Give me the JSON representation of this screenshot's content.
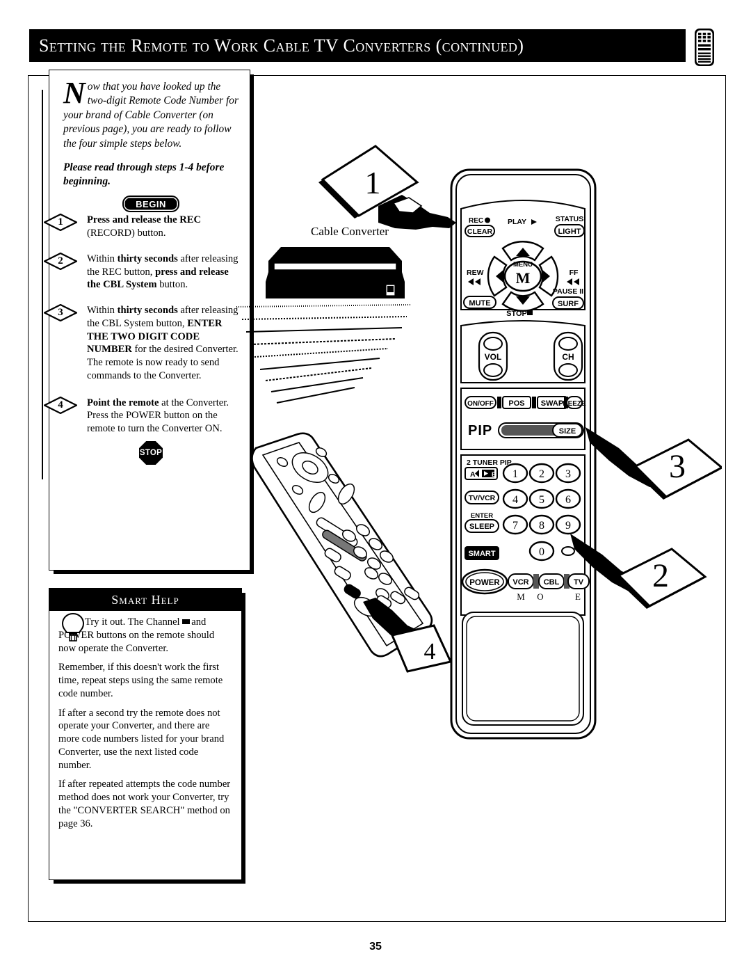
{
  "header": {
    "title": "Setting the Remote to Work Cable TV Converters (continued)",
    "icon": "remote-control-icon"
  },
  "intro": {
    "dropcap": "N",
    "text": "ow that you have looked up the two-digit Remote Code Number for your brand of Cable Converter (on previous page), you are ready to follow the four simple steps below.",
    "emphasis": "Please read through steps 1-4 before beginning.",
    "begin_badge": "BEGIN",
    "stop_badge": "STOP"
  },
  "steps": [
    {
      "number": "1",
      "bold_lead": "Press and release the REC",
      "rest": " (RECORD) button."
    },
    {
      "number": "2",
      "bold_lead": "",
      "rest": "Within thirty seconds after releasing the REC button, press and release the CBL System button."
    },
    {
      "number": "3",
      "bold_lead": "",
      "rest": "Within thirty seconds after releasing the CBL System button, ENTER THE TWO DIGIT CODE NUMBER for the desired Converter. The remote is now ready to send commands to the Converter."
    },
    {
      "number": "4",
      "bold_lead": "Point the remote",
      "rest": " at the Converter. Press the POWER button on the remote to turn the Converter ON."
    }
  ],
  "smart_help": {
    "title": "Smart Help",
    "icon": "lightbulb-icon",
    "paragraphs": [
      "Try it out. The Channel   and POWER buttons on the remote should now operate the Converter.",
      "Remember, if this doesn't work the first time, repeat steps using the same remote code number.",
      "If after a second try the remote does not operate your Converter, and there are more code numbers listed for your brand Converter, use the next listed code number.",
      "If after repeated attempts the code number method does not work your Converter, try the \"CONVERTER SEARCH\" method on page 36."
    ]
  },
  "illustration": {
    "converter_label": "Cable Converter",
    "callouts": [
      "1",
      "2",
      "3",
      "4"
    ],
    "remote_buttons": {
      "rec": "REC",
      "clear": "CLEAR",
      "play": "PLAY",
      "status": "STATUS",
      "light": "LIGHT",
      "rew": "REW",
      "ff": "FF",
      "menu": "MENU",
      "menu_m": "M",
      "mute": "MUTE",
      "stop": "STOP",
      "pause": "PAUSE II",
      "surf": "SURF",
      "vol": "VOL",
      "ch": "CH",
      "pip_onoff": "ON/OFF",
      "pip_pos": "POS",
      "pip_swap": "SWAP",
      "pip_freeze": "FREEZE",
      "pip": "PIP",
      "pip_size": "SIZE",
      "tuner_pip": "2 TUNER PIP",
      "ab": "A",
      "b": "B",
      "tvvcr": "TV/VCR",
      "enter": "ENTER",
      "sleep": "SLEEP",
      "smart": "SMART",
      "power": "POWER",
      "vcr": "VCR",
      "cbl": "CBL",
      "tv": "TV",
      "keys": [
        "1",
        "2",
        "3",
        "4",
        "5",
        "6",
        "7",
        "8",
        "9",
        "0"
      ],
      "brand_letters": [
        "M",
        "O",
        "E"
      ]
    }
  },
  "footer": {
    "page_number": "35"
  }
}
